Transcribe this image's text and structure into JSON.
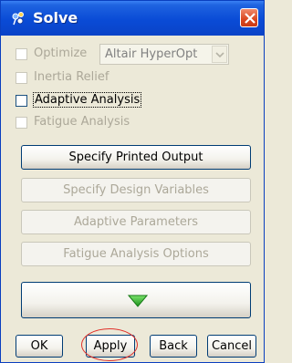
{
  "window": {
    "title": "Solve",
    "app_icon": "hyperworks-icon",
    "close_icon": "close-icon"
  },
  "options": [
    {
      "label": "Optimize",
      "checked": false,
      "enabled": false
    },
    {
      "label": "Inertia Relief",
      "checked": false,
      "enabled": false
    },
    {
      "label": "Adaptive Analysis",
      "checked": false,
      "enabled": true,
      "focused": true
    },
    {
      "label": "Fatigue Analysis",
      "checked": false,
      "enabled": false
    }
  ],
  "optimizer_select": {
    "value": "Altair HyperOpt",
    "enabled": false
  },
  "action_buttons": [
    {
      "label": "Specify Printed Output",
      "enabled": true
    },
    {
      "label": "Specify Design Variables",
      "enabled": false
    },
    {
      "label": "Adaptive Parameters",
      "enabled": false
    },
    {
      "label": "Fatigue Analysis Options",
      "enabled": false
    }
  ],
  "run_button": {
    "icon": "green-down-arrow-icon",
    "color": "#22a522"
  },
  "footer": {
    "ok": "OK",
    "apply": "Apply",
    "back": "Back",
    "cancel": "Cancel"
  },
  "colors": {
    "titlebar": "#0a4bd6",
    "dialog_bg": "#ece9d8",
    "close_button": "#d9461f",
    "highlight_circle": "#e0302a"
  }
}
